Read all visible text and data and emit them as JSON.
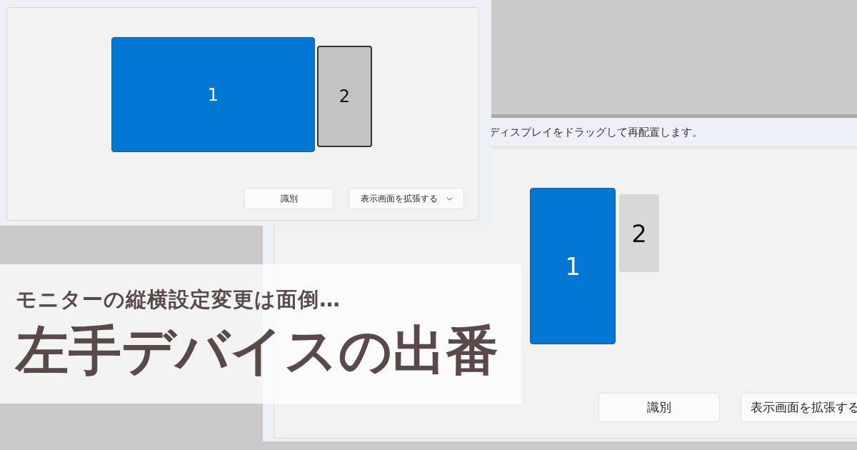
{
  "front_screenshot": {
    "displays": [
      {
        "number": "1",
        "selected": true
      },
      {
        "number": "2",
        "selected": false
      }
    ],
    "buttons": [
      {
        "label": "識別",
        "kind": "plain"
      },
      {
        "label": "表示画面を拡張する",
        "kind": "dropdown"
      }
    ]
  },
  "back_screenshot": {
    "instruction": "ディスプレイをドラッグして再配置します。",
    "displays": [
      {
        "number": "1",
        "selected": true
      },
      {
        "number": "2",
        "selected": false
      }
    ],
    "buttons": [
      {
        "label": "識別"
      },
      {
        "label": "表示画面を拡張する"
      }
    ]
  },
  "banner": {
    "subtitle": "モニターの縦横設定変更は面倒…",
    "title": "左手デバイスの出番"
  }
}
